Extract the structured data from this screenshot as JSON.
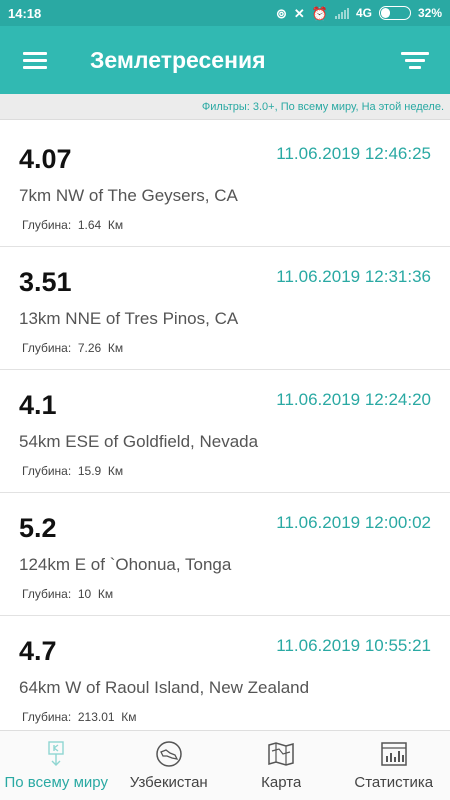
{
  "status_bar": {
    "time": "14:18",
    "network": "4G",
    "battery_text": "32%",
    "battery_level": 0.32
  },
  "app_bar": {
    "title": "Землетресения",
    "menu_icon": "hamburger-menu-icon",
    "filter_icon": "filter-icon"
  },
  "filters_text": "Фильтры: 3.0+, По всему миру, На этой неделе.",
  "depth_label": "Глубина:",
  "depth_unit": "Км",
  "earthquakes": [
    {
      "magnitude": "4.07",
      "datetime": "11.06.2019 12:46:25",
      "place": "7km NW of The Geysers, CA",
      "depth": "1.64"
    },
    {
      "magnitude": "3.51",
      "datetime": "11.06.2019 12:31:36",
      "place": "13km NNE of Tres Pinos, CA",
      "depth": "7.26"
    },
    {
      "magnitude": "4.1",
      "datetime": "11.06.2019 12:24:20",
      "place": "54km ESE of Goldfield, Nevada",
      "depth": "15.9"
    },
    {
      "magnitude": "5.2",
      "datetime": "11.06.2019 12:00:02",
      "place": "124km E of `Ohonua, Tonga",
      "depth": "10"
    },
    {
      "magnitude": "4.7",
      "datetime": "11.06.2019 10:55:21",
      "place": "64km W of Raoul Island, New Zealand",
      "depth": "213.01"
    }
  ],
  "bottom_nav": [
    {
      "label": "По всему миру",
      "icon": "world-list-icon",
      "active": true
    },
    {
      "label": "Узбекистан",
      "icon": "uzbekistan-map-icon",
      "active": false
    },
    {
      "label": "Карта",
      "icon": "map-icon",
      "active": false
    },
    {
      "label": "Статистика",
      "icon": "statistics-icon",
      "active": false
    }
  ],
  "colors": {
    "accent": "#2aa9a3",
    "app_bar": "#31b9b2",
    "status_bar": "#2aa9a3"
  }
}
